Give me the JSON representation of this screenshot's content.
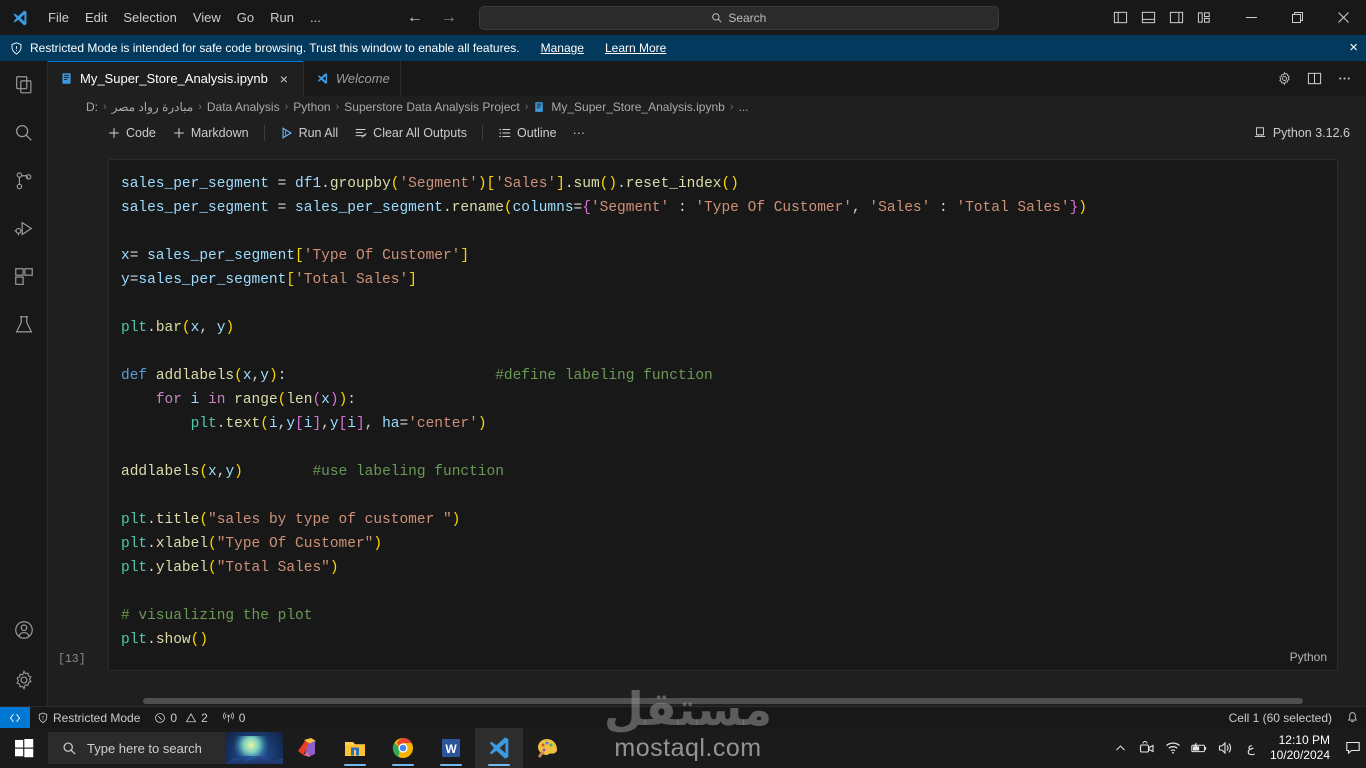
{
  "titlebar": {
    "menus": [
      "File",
      "Edit",
      "Selection",
      "View",
      "Go",
      "Run",
      "..."
    ],
    "search_placeholder": "Search",
    "search_icon": "search-icon",
    "back_icon": "arrow-left-icon",
    "forward_icon": "arrow-right-icon",
    "layout_icons": [
      "toggle-primary-sidebar-icon",
      "toggle-panel-icon",
      "toggle-secondary-sidebar-icon",
      "customize-layout-icon"
    ],
    "window_controls": [
      "minimize",
      "restore",
      "close"
    ]
  },
  "banner": {
    "text": "Restricted Mode is intended for safe code browsing. Trust this window to enable all features.",
    "manage": "Manage",
    "learn_more": "Learn More",
    "shield_icon": "shield-icon",
    "close_icon": "close-icon",
    "background": "#04395e"
  },
  "activitybar": {
    "items": [
      {
        "name": "explorer",
        "icon": "files-icon"
      },
      {
        "name": "search",
        "icon": "search-icon"
      },
      {
        "name": "source-control",
        "icon": "source-control-icon"
      },
      {
        "name": "run-and-debug",
        "icon": "run-debug-icon"
      },
      {
        "name": "extensions",
        "icon": "extensions-icon"
      },
      {
        "name": "testing",
        "icon": "beaker-icon"
      }
    ],
    "bottom": [
      {
        "name": "accounts",
        "icon": "account-icon"
      },
      {
        "name": "manage",
        "icon": "gear-icon"
      }
    ]
  },
  "tabs": [
    {
      "label": "My_Super_Store_Analysis.ipynb",
      "icon": "notebook-icon",
      "active": true,
      "close": "×"
    },
    {
      "label": "Welcome",
      "icon": "vscode-icon",
      "active": false
    }
  ],
  "tab_actions": [
    "gear-icon",
    "split-editor-icon",
    "more-actions-icon"
  ],
  "breadcrumb": {
    "items": [
      "D:",
      "مبادرة رواد مصر",
      "Data Analysis",
      "Python",
      "Superstore Data Analysis Project",
      "My_Super_Store_Analysis.ipynb",
      "..."
    ],
    "separator": "›",
    "file_icon": "notebook-icon"
  },
  "notebook_toolbar": {
    "buttons": [
      {
        "label": "Code",
        "icon": "plus-icon"
      },
      {
        "label": "Markdown",
        "icon": "plus-icon"
      },
      {
        "label": "Run All",
        "icon": "run-all-icon"
      },
      {
        "label": "Clear All Outputs",
        "icon": "clear-outputs-icon"
      },
      {
        "label": "Outline",
        "icon": "outline-icon"
      },
      {
        "label": "···",
        "icon": "more-icon"
      }
    ],
    "kernel": "Python 3.12.6",
    "kernel_icon": "kernel-icon"
  },
  "cell": {
    "execution_count": "[13]",
    "language": "Python",
    "code_lines": [
      [
        {
          "t": "sales_per_segment ",
          "c": "t-var"
        },
        {
          "t": "= ",
          "c": "t-op"
        },
        {
          "t": "df1",
          "c": "t-var"
        },
        {
          "t": ".",
          "c": "t-op"
        },
        {
          "t": "groupby",
          "c": "t-fn"
        },
        {
          "t": "(",
          "c": "t-p1"
        },
        {
          "t": "'Segment'",
          "c": "t-str"
        },
        {
          "t": ")",
          "c": "t-p1"
        },
        {
          "t": "[",
          "c": "t-p1"
        },
        {
          "t": "'Sales'",
          "c": "t-str"
        },
        {
          "t": "]",
          "c": "t-p1"
        },
        {
          "t": ".",
          "c": "t-op"
        },
        {
          "t": "sum",
          "c": "t-fn"
        },
        {
          "t": "()",
          "c": "t-p1"
        },
        {
          "t": ".",
          "c": "t-op"
        },
        {
          "t": "reset_index",
          "c": "t-fn"
        },
        {
          "t": "()",
          "c": "t-p1"
        }
      ],
      [
        {
          "t": "sales_per_segment ",
          "c": "t-var"
        },
        {
          "t": "= ",
          "c": "t-op"
        },
        {
          "t": "sales_per_segment",
          "c": "t-var"
        },
        {
          "t": ".",
          "c": "t-op"
        },
        {
          "t": "rename",
          "c": "t-fn"
        },
        {
          "t": "(",
          "c": "t-p1"
        },
        {
          "t": "columns",
          "c": "t-var"
        },
        {
          "t": "=",
          "c": "t-op"
        },
        {
          "t": "{",
          "c": "t-p2"
        },
        {
          "t": "'Segment'",
          "c": "t-str"
        },
        {
          "t": " : ",
          "c": "t-op"
        },
        {
          "t": "'Type Of Customer'",
          "c": "t-str"
        },
        {
          "t": ", ",
          "c": "t-op"
        },
        {
          "t": "'Sales'",
          "c": "t-str"
        },
        {
          "t": " : ",
          "c": "t-op"
        },
        {
          "t": "'Total Sales'",
          "c": "t-str"
        },
        {
          "t": "}",
          "c": "t-p2"
        },
        {
          "t": ")",
          "c": "t-p1"
        }
      ],
      [],
      [
        {
          "t": "x",
          "c": "t-var"
        },
        {
          "t": "= ",
          "c": "t-op"
        },
        {
          "t": "sales_per_segment",
          "c": "t-var"
        },
        {
          "t": "[",
          "c": "t-p1"
        },
        {
          "t": "'Type Of Customer'",
          "c": "t-str"
        },
        {
          "t": "]",
          "c": "t-p1"
        }
      ],
      [
        {
          "t": "y",
          "c": "t-var"
        },
        {
          "t": "=",
          "c": "t-op"
        },
        {
          "t": "sales_per_segment",
          "c": "t-var"
        },
        {
          "t": "[",
          "c": "t-p1"
        },
        {
          "t": "'Total Sales'",
          "c": "t-str"
        },
        {
          "t": "]",
          "c": "t-p1"
        }
      ],
      [],
      [
        {
          "t": "plt",
          "c": "t-mod"
        },
        {
          "t": ".",
          "c": "t-op"
        },
        {
          "t": "bar",
          "c": "t-fn"
        },
        {
          "t": "(",
          "c": "t-p1"
        },
        {
          "t": "x",
          "c": "t-var"
        },
        {
          "t": ", ",
          "c": "t-op"
        },
        {
          "t": "y",
          "c": "t-var"
        },
        {
          "t": ")",
          "c": "t-p1"
        }
      ],
      [],
      [
        {
          "t": "def ",
          "c": "t-kw2"
        },
        {
          "t": "addlabels",
          "c": "t-fn"
        },
        {
          "t": "(",
          "c": "t-p1"
        },
        {
          "t": "x",
          "c": "t-var"
        },
        {
          "t": ",",
          "c": "t-op"
        },
        {
          "t": "y",
          "c": "t-var"
        },
        {
          "t": ")",
          "c": "t-p1"
        },
        {
          "t": ":",
          "c": "t-op"
        },
        {
          "t": "                        ",
          "c": "t-op"
        },
        {
          "t": "#define labeling function",
          "c": "t-cmt"
        }
      ],
      [
        {
          "t": "    ",
          "c": "t-op"
        },
        {
          "t": "for ",
          "c": "t-kw"
        },
        {
          "t": "i ",
          "c": "t-var"
        },
        {
          "t": "in ",
          "c": "t-kw"
        },
        {
          "t": "range",
          "c": "t-fn"
        },
        {
          "t": "(",
          "c": "t-p1"
        },
        {
          "t": "len",
          "c": "t-fn"
        },
        {
          "t": "(",
          "c": "t-p2"
        },
        {
          "t": "x",
          "c": "t-var"
        },
        {
          "t": ")",
          "c": "t-p2"
        },
        {
          "t": ")",
          "c": "t-p1"
        },
        {
          "t": ":",
          "c": "t-op"
        }
      ],
      [
        {
          "t": "        ",
          "c": "t-op"
        },
        {
          "t": "plt",
          "c": "t-mod"
        },
        {
          "t": ".",
          "c": "t-op"
        },
        {
          "t": "text",
          "c": "t-fn"
        },
        {
          "t": "(",
          "c": "t-p1"
        },
        {
          "t": "i",
          "c": "t-var"
        },
        {
          "t": ",",
          "c": "t-op"
        },
        {
          "t": "y",
          "c": "t-var"
        },
        {
          "t": "[",
          "c": "t-p2"
        },
        {
          "t": "i",
          "c": "t-var"
        },
        {
          "t": "]",
          "c": "t-p2"
        },
        {
          "t": ",",
          "c": "t-op"
        },
        {
          "t": "y",
          "c": "t-var"
        },
        {
          "t": "[",
          "c": "t-p2"
        },
        {
          "t": "i",
          "c": "t-var"
        },
        {
          "t": "]",
          "c": "t-p2"
        },
        {
          "t": ", ",
          "c": "t-op"
        },
        {
          "t": "ha",
          "c": "t-var"
        },
        {
          "t": "=",
          "c": "t-op"
        },
        {
          "t": "'center'",
          "c": "t-str"
        },
        {
          "t": ")",
          "c": "t-p1"
        }
      ],
      [],
      [
        {
          "t": "addlabels",
          "c": "t-fn"
        },
        {
          "t": "(",
          "c": "t-p1"
        },
        {
          "t": "x",
          "c": "t-var"
        },
        {
          "t": ",",
          "c": "t-op"
        },
        {
          "t": "y",
          "c": "t-var"
        },
        {
          "t": ")",
          "c": "t-p1"
        },
        {
          "t": "        ",
          "c": "t-op"
        },
        {
          "t": "#use labeling function",
          "c": "t-cmt"
        }
      ],
      [],
      [
        {
          "t": "plt",
          "c": "t-mod"
        },
        {
          "t": ".",
          "c": "t-op"
        },
        {
          "t": "title",
          "c": "t-fn"
        },
        {
          "t": "(",
          "c": "t-p1"
        },
        {
          "t": "\"sales by type of customer \"",
          "c": "t-str"
        },
        {
          "t": ")",
          "c": "t-p1"
        }
      ],
      [
        {
          "t": "plt",
          "c": "t-mod"
        },
        {
          "t": ".",
          "c": "t-op"
        },
        {
          "t": "xlabel",
          "c": "t-fn"
        },
        {
          "t": "(",
          "c": "t-p1"
        },
        {
          "t": "\"Type Of Customer\"",
          "c": "t-str"
        },
        {
          "t": ")",
          "c": "t-p1"
        }
      ],
      [
        {
          "t": "plt",
          "c": "t-mod"
        },
        {
          "t": ".",
          "c": "t-op"
        },
        {
          "t": "ylabel",
          "c": "t-fn"
        },
        {
          "t": "(",
          "c": "t-p1"
        },
        {
          "t": "\"Total Sales\"",
          "c": "t-str"
        },
        {
          "t": ")",
          "c": "t-p1"
        }
      ],
      [],
      [
        {
          "t": "# visualizing the plot",
          "c": "t-cmt"
        }
      ],
      [
        {
          "t": "plt",
          "c": "t-mod"
        },
        {
          "t": ".",
          "c": "t-op"
        },
        {
          "t": "show",
          "c": "t-fn"
        },
        {
          "t": "()",
          "c": "t-p1"
        }
      ]
    ]
  },
  "statusbar": {
    "remote_icon": "remote-indicator-icon",
    "restricted_mode": "Restricted Mode",
    "shield_icon": "shield-icon",
    "errors": "0",
    "warnings": "2",
    "ports": "0",
    "error_icon": "error-icon",
    "warning_icon": "warning-icon",
    "ports_icon": "radio-tower-icon",
    "cell_status": "Cell 1 (60 selected)",
    "bell_icon": "bell-icon"
  },
  "taskbar": {
    "start_icon": "windows-start-icon",
    "search_placeholder": "Type here to search",
    "search_icon": "search-icon",
    "apps": [
      {
        "name": "office-icon"
      },
      {
        "name": "file-explorer-icon"
      },
      {
        "name": "chrome-icon"
      },
      {
        "name": "word-icon"
      },
      {
        "name": "vscode-icon",
        "active": true
      },
      {
        "name": "paint-icon"
      }
    ],
    "tray": {
      "chevron_icon": "show-hidden-icons-icon",
      "meet_icon": "meet-now-icon",
      "wifi_icon": "wifi-icon",
      "battery_icon": "battery-charging-icon",
      "volume_icon": "volume-icon",
      "language": "ع",
      "time": "12:10 PM",
      "date": "10/20/2024",
      "notification_icon": "notifications-icon"
    }
  },
  "watermark": {
    "arabic": "مستقل",
    "latin": "mostaql.com"
  }
}
